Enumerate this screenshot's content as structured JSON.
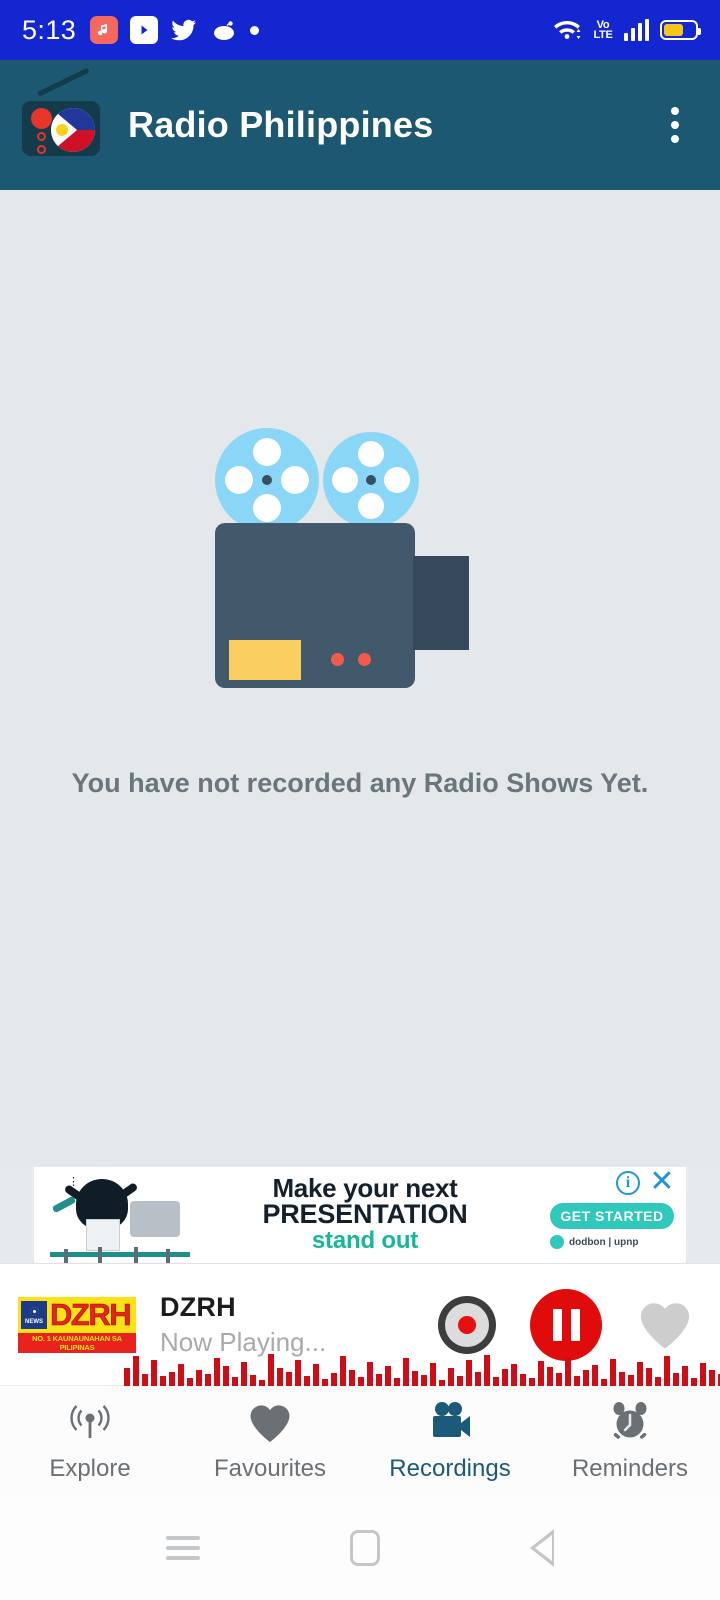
{
  "statusbar": {
    "time": "5:13",
    "icons": [
      "music-icon",
      "youtube-icon",
      "twitter-icon",
      "reddit-icon",
      "dot-icon"
    ],
    "wifi": "wifi-icon",
    "network_label": "VoLTE",
    "network_line1": "Vo",
    "network_line2": "LTE",
    "signal": "signal-bars-icon",
    "battery": "battery-icon",
    "battery_level": 62,
    "bg_color": "#1426cf"
  },
  "appbar": {
    "title": "Radio Philippines",
    "logo": "radio-philippines-logo",
    "overflow": "overflow-menu-icon",
    "bg_color": "#1d5873"
  },
  "main": {
    "illustration": "video-camera-illustration",
    "empty_message": "You have not recorded any Radio Shows Yet."
  },
  "ad": {
    "line1": "Make your next",
    "line2": "PRESENTATION",
    "line3": "stand out",
    "cta": "GET STARTED",
    "brand": "dodbon | upnp",
    "info_icon": "info-icon",
    "close_icon": "close-icon",
    "info_glyph": "i",
    "close_glyph": "✕",
    "accent_color": "#2ec9bb"
  },
  "player": {
    "station_logo_text": "DZRH",
    "station_logo_badge": "NEWS",
    "station_logo_tagline": "NO. 1 KAUNAUNAHAN SA PILIPINAS",
    "station_name": "DZRH",
    "status": "Now Playing...",
    "record_button": "record-button",
    "pause_button": "pause-button",
    "favourite_button": "favourite-heart-button",
    "waveform": [
      18,
      30,
      12,
      26,
      10,
      14,
      22,
      8,
      16,
      12,
      28,
      20,
      9,
      24,
      11,
      6,
      32,
      18,
      14,
      26,
      10,
      22,
      7,
      13,
      30,
      16,
      9,
      24,
      12,
      20,
      8,
      28,
      15,
      11,
      23,
      6,
      18,
      10,
      26,
      14,
      31,
      9,
      17,
      22,
      12,
      8,
      25,
      19,
      13,
      29,
      10,
      16,
      21,
      7,
      27,
      14,
      11,
      24,
      18,
      9,
      30,
      13,
      20,
      8,
      23,
      16,
      12,
      28,
      10,
      26
    ],
    "waveform_color": "#cf0d16"
  },
  "bottomnav": {
    "items": [
      {
        "label": "Explore",
        "icon": "broadcast-icon",
        "active": false
      },
      {
        "label": "Favourites",
        "icon": "heart-icon",
        "active": false
      },
      {
        "label": "Recordings",
        "icon": "video-camera-icon",
        "active": true
      },
      {
        "label": "Reminders",
        "icon": "alarm-clock-icon",
        "active": false
      }
    ],
    "active_color": "#1c5a79",
    "inactive_color": "#6b7075"
  },
  "sysnav": {
    "recents": "recents-icon",
    "home": "home-icon",
    "back": "back-icon"
  }
}
